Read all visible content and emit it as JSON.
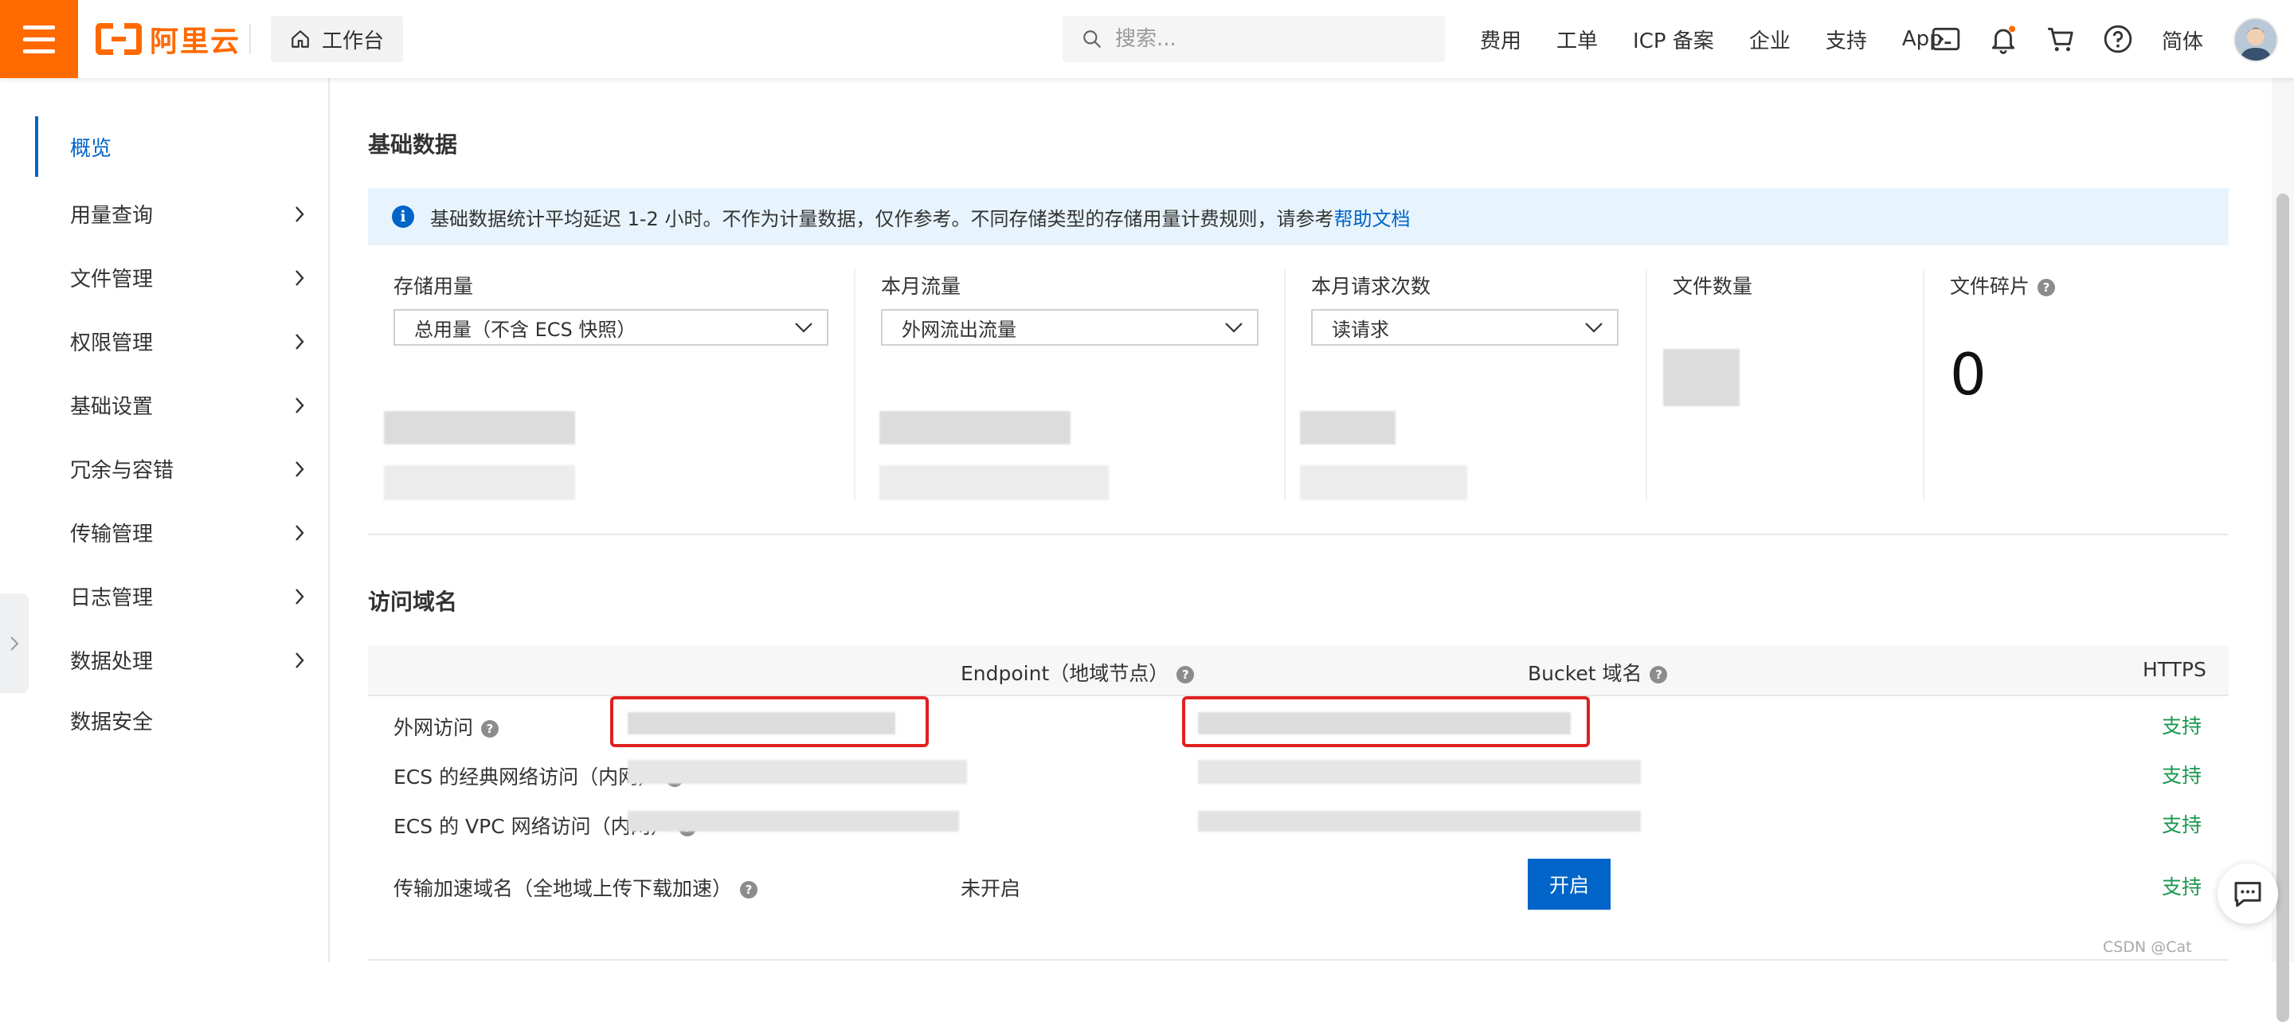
{
  "topbar": {
    "logo_text": "阿里云",
    "workbench_label": "工作台",
    "search_placeholder": "搜索...",
    "links": [
      "费用",
      "工单",
      "ICP 备案",
      "企业",
      "支持",
      "App"
    ],
    "language": "简体",
    "accent_color": "#ff6a00"
  },
  "sidebar": {
    "items": [
      {
        "label": "概览",
        "active": true
      },
      {
        "label": "用量查询"
      },
      {
        "label": "文件管理"
      },
      {
        "label": "权限管理"
      },
      {
        "label": "基础设置"
      },
      {
        "label": "冗余与容错"
      },
      {
        "label": "传输管理"
      },
      {
        "label": "日志管理"
      },
      {
        "label": "数据处理"
      },
      {
        "label": "数据安全"
      }
    ]
  },
  "basic_data": {
    "title": "基础数据",
    "notice_text": "基础数据统计平均延迟 1-2 小时。不作为计量数据，仅作参考。不同存储类型的存储用量计费规则，请参考",
    "notice_link": "帮助文档",
    "stats": [
      {
        "label": "存储用量",
        "select": "总用量（不含 ECS 快照）"
      },
      {
        "label": "本月流量",
        "select": "外网流出流量"
      },
      {
        "label": "本月请求次数",
        "select": "读请求"
      },
      {
        "label": "文件数量"
      },
      {
        "label": "文件碎片",
        "value": "0"
      }
    ]
  },
  "access_domain": {
    "title": "访问域名",
    "columns": [
      "Endpoint（地域节点）",
      "Bucket 域名",
      "HTTPS"
    ],
    "rows": [
      {
        "label": "外网访问",
        "https": "支持"
      },
      {
        "label": "ECS 的经典网络访问（内网）",
        "https": "支持"
      },
      {
        "label": "ECS 的 VPC 网络访问（内网）",
        "https": "支持"
      },
      {
        "label": "传输加速域名（全地域上传下载加速）",
        "endpoint": "未开启",
        "bucket_button": "开启",
        "https": "支持"
      }
    ]
  },
  "watermark": "CSDN @Cat"
}
